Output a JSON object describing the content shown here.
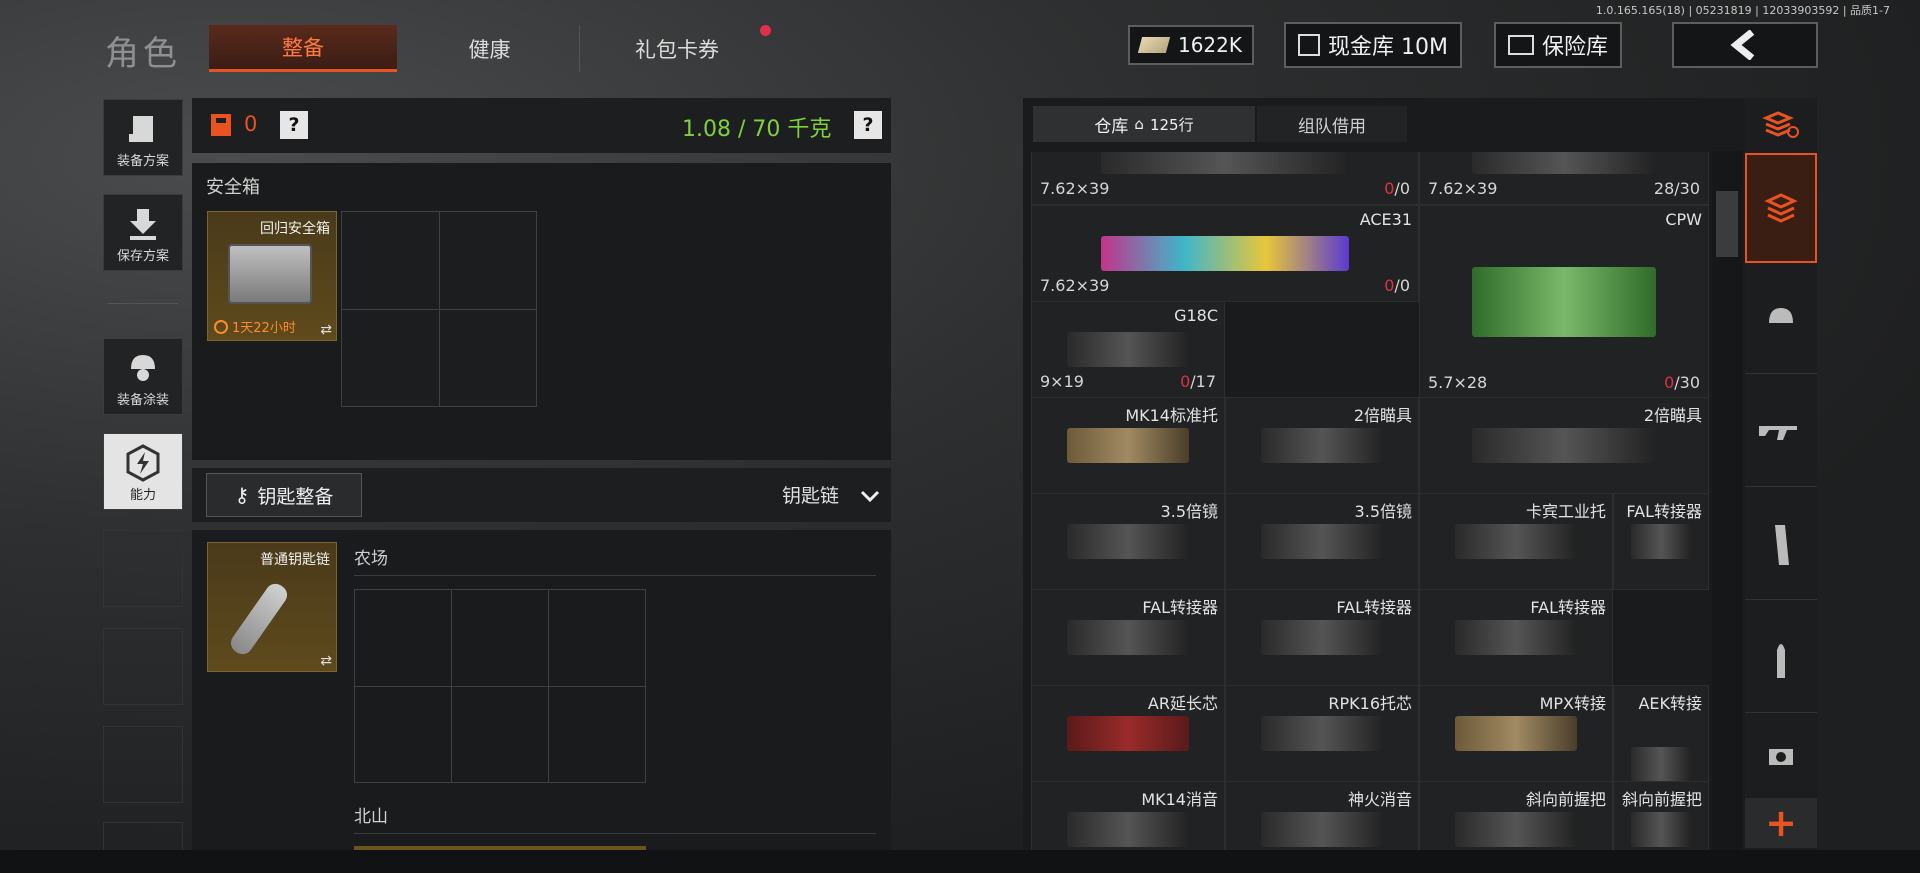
{
  "version": "1.0.165.165(18) | 05231819 | 12033903592 | 品质1-7",
  "header": {
    "title": "角色",
    "tabs": [
      {
        "label": "整备"
      },
      {
        "label": "健康"
      },
      {
        "label": "礼包卡券"
      }
    ],
    "money": "1622K",
    "cash_vault": "现金库 10M",
    "safe": "保险库"
  },
  "sidebar": [
    {
      "label": "装备方案"
    },
    {
      "label": "保存方案"
    },
    {
      "label": "装备涂装"
    },
    {
      "label": "能力"
    }
  ],
  "loadout": {
    "armor_value": "0",
    "help": "?",
    "weight": "1.08 / 70 千克"
  },
  "safebox": {
    "title": "安全箱",
    "item": "回归安全箱",
    "timer": "1天22小时"
  },
  "keys": {
    "button": "钥匙整备",
    "dropdown": "钥匙链",
    "item": "普通钥匙链",
    "zone1": "农场",
    "zone2": "北山"
  },
  "storage": {
    "tab1": "仓库",
    "rows": "125行",
    "tab2": "组队借用",
    "items": [
      {
        "name": "",
        "caliber": "7.62×39",
        "count": "0",
        "max": "/0"
      },
      {
        "name": "",
        "caliber": "7.62×39",
        "count": "28",
        "max": "/30"
      },
      {
        "name": "ACE31",
        "caliber": "7.62×39",
        "count": "0",
        "max": "/0"
      },
      {
        "name": "CPW",
        "caliber": "5.7×28",
        "count": "0",
        "max": "/30"
      },
      {
        "name": "G18C",
        "caliber": "9×19",
        "count": "0",
        "max": "/17"
      },
      {
        "name": "MK14标准托"
      },
      {
        "name": "2倍瞄具"
      },
      {
        "name": "2倍瞄具"
      },
      {
        "name": "3.5倍镜"
      },
      {
        "name": "3.5倍镜"
      },
      {
        "name": "卡宾工业托"
      },
      {
        "name": "FAL转接器"
      },
      {
        "name": "FAL转接器"
      },
      {
        "name": "FAL转接器"
      },
      {
        "name": "FAL转接器"
      },
      {
        "name": "AR延长芯"
      },
      {
        "name": "RPK16托芯"
      },
      {
        "name": "MPX转接"
      },
      {
        "name": "AEK转接"
      },
      {
        "name": "MK14消音"
      },
      {
        "name": "神火消音"
      },
      {
        "name": "斜向前握把"
      },
      {
        "name": "斜向前握把"
      }
    ]
  },
  "colors": {
    "accent": "#e8531f",
    "weight": "#7fd13b",
    "alert": "#e0304a"
  }
}
